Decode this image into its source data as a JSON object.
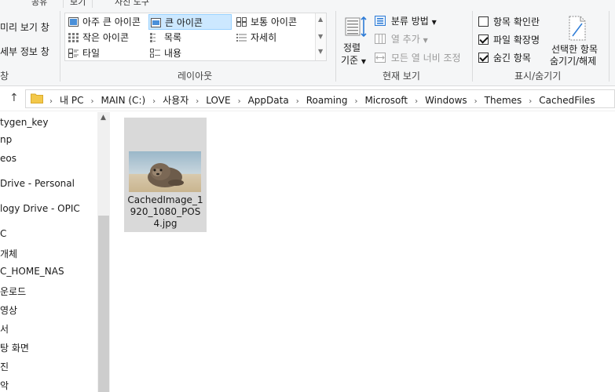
{
  "ribbon": {
    "tabs": [
      "보기",
      "공유",
      "보기",
      "사진 도구"
    ],
    "panes": {
      "preview_pane": "미리 보기 창",
      "details_pane": "세부 정보 창",
      "group_label": "창"
    },
    "layout": {
      "items": [
        "아주 큰 아이콘",
        "큰 아이콘",
        "보통 아이콘",
        "작은 아이콘",
        "목록",
        "자세히",
        "타일",
        "내용"
      ],
      "selected": "큰 아이콘",
      "group_label": "레이아웃"
    },
    "current_view": {
      "sort_by_line1": "정렬",
      "sort_by_line2": "기준",
      "group_by": "분류 방법",
      "add_columns": "열 추가",
      "size_all_columns": "모든 열 너비 조정",
      "group_label": "현재 보기"
    },
    "show_hide": {
      "item_check_boxes": "항목 확인란",
      "file_name_extensions": "파일 확장명",
      "hidden_items": "숨긴 항목",
      "hide_selected_line1": "선택한 항목",
      "hide_selected_line2": "숨기기/해제",
      "group_label": "표시/숨기기",
      "item_check_boxes_checked": false,
      "file_name_extensions_checked": true,
      "hidden_items_checked": true
    }
  },
  "address": {
    "crumbs": [
      "내 PC",
      "MAIN (C:)",
      "사용자",
      "LOVE",
      "AppData",
      "Roaming",
      "Microsoft",
      "Windows",
      "Themes",
      "CachedFiles"
    ]
  },
  "nav": {
    "items": [
      "tygen_key",
      "np",
      "eos",
      "Drive - Personal",
      "logy Drive - OPIC",
      "C",
      "개체",
      "C_HOME_NAS",
      "운로드",
      "영상",
      "서",
      "탕 화면",
      "진",
      "악"
    ]
  },
  "files": [
    {
      "name": "CachedImage_1920_1080_POS4.jpg"
    }
  ]
}
